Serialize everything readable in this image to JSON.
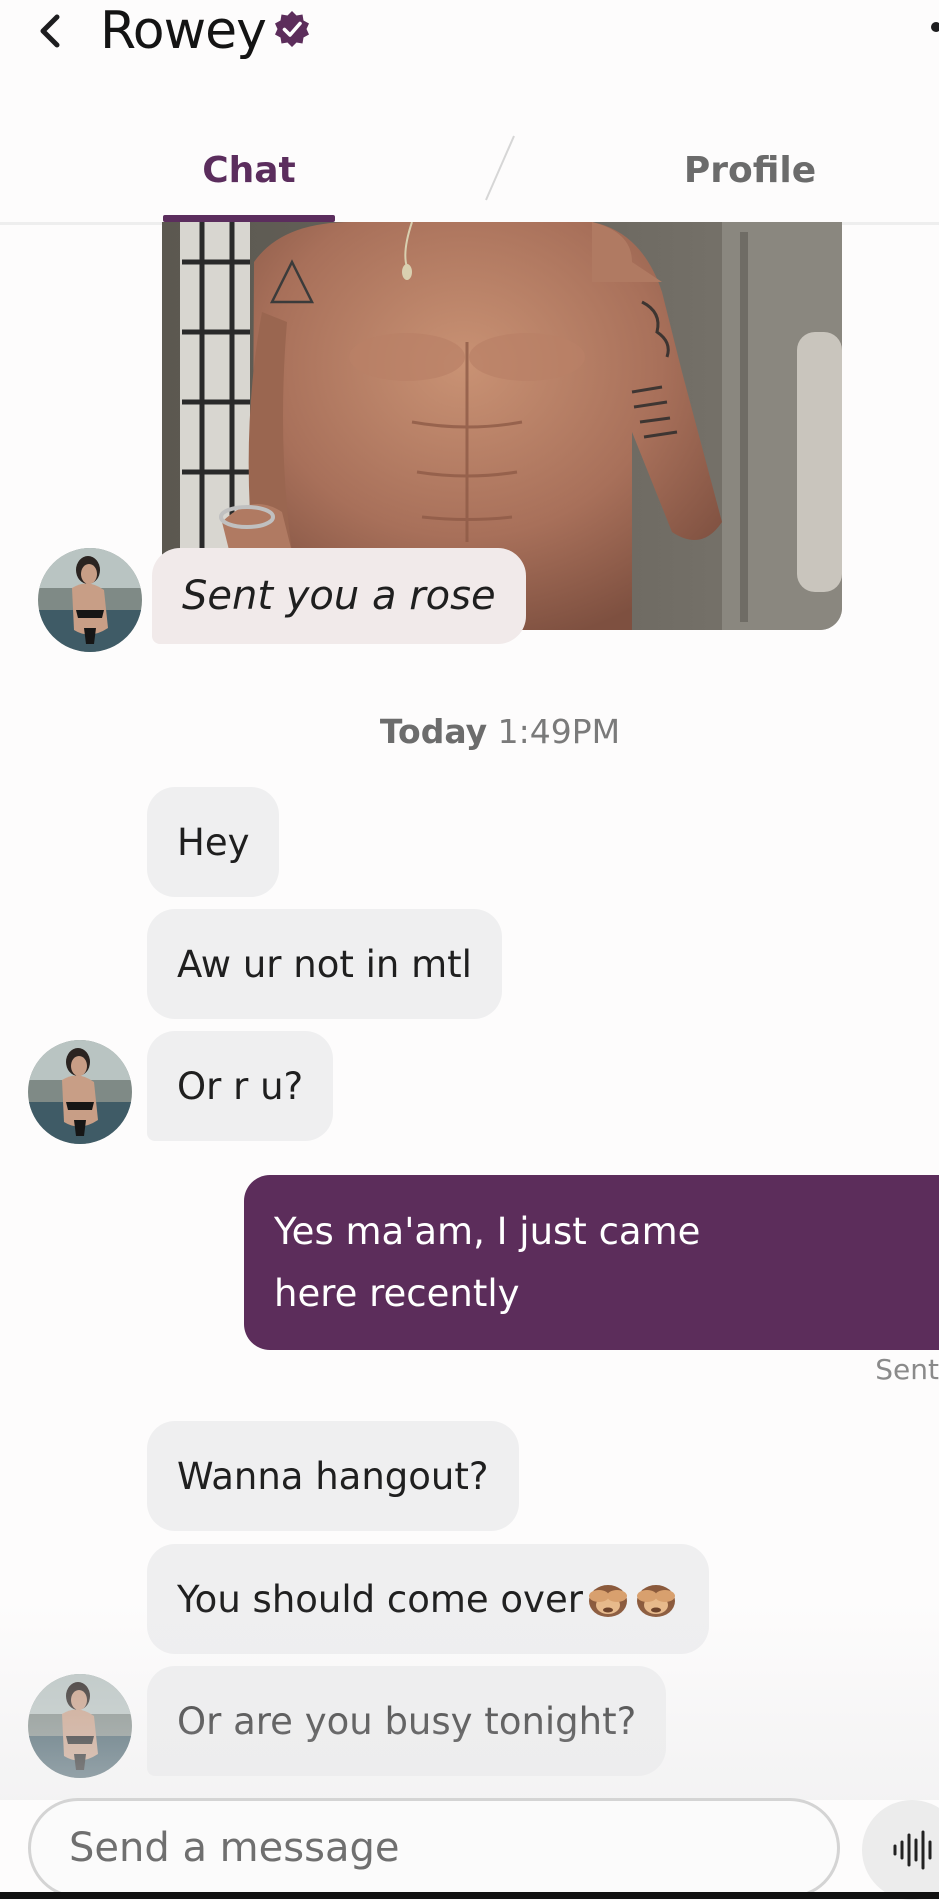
{
  "header": {
    "back_icon": "chevron-left-icon",
    "title": "Rowey",
    "verified_icon": "verified-badge-icon",
    "more_icon": "more-dots-icon"
  },
  "tabs": [
    {
      "label": "Chat",
      "active": true
    },
    {
      "label": "Profile",
      "active": false
    }
  ],
  "colors": {
    "accent": "#5c2d5b",
    "incoming_bubble": "#efeff0",
    "rose_bubble": "#f1eaea"
  },
  "messages": {
    "rose": "Sent you a rose",
    "timestamp_day": "Today",
    "timestamp_time": "1:49PM",
    "group1": [
      "Hey",
      "Aw ur not in mtl",
      "Or r u?"
    ],
    "outgoing": "Yes ma'am, I just came here recently",
    "sent_status": "Sent",
    "group2": [
      "Wanna hangout?",
      "You should come over",
      "Or are you busy tonight?"
    ],
    "emoji": "see-no-evil-monkey-icon"
  },
  "composer": {
    "placeholder": "Send a message",
    "voice_icon": "voice-wave-icon"
  }
}
